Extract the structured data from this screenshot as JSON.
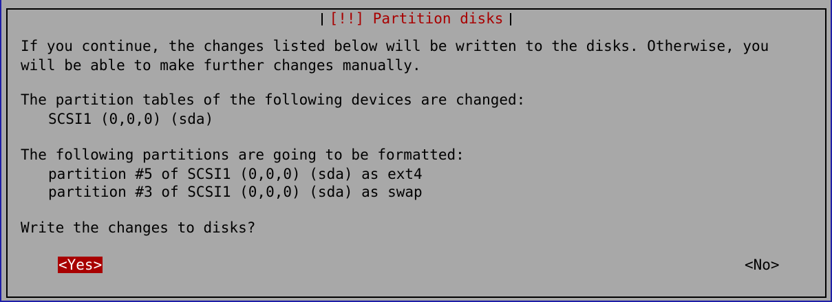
{
  "dialog": {
    "title": "[!!] Partition disks",
    "intro_line1": "If you continue, the changes listed below will be written to the disks. Otherwise, you",
    "intro_line2": "will be able to make further changes manually.",
    "tables_heading": "The partition tables of the following devices are changed:",
    "devices": [
      "SCSI1 (0,0,0) (sda)"
    ],
    "format_heading": "The following partitions are going to be formatted:",
    "partitions": [
      "partition #5 of SCSI1 (0,0,0) (sda) as ext4",
      "partition #3 of SCSI1 (0,0,0) (sda) as swap"
    ],
    "question": "Write the changes to disks?",
    "yes_label": "<Yes>",
    "no_label": "<No>"
  },
  "colors": {
    "background": "#1f1fa8",
    "dialog": "#a8a8a8",
    "title_text": "#a80000",
    "selected_button_bg": "#a80000",
    "selected_button_text": "#ffffff"
  }
}
